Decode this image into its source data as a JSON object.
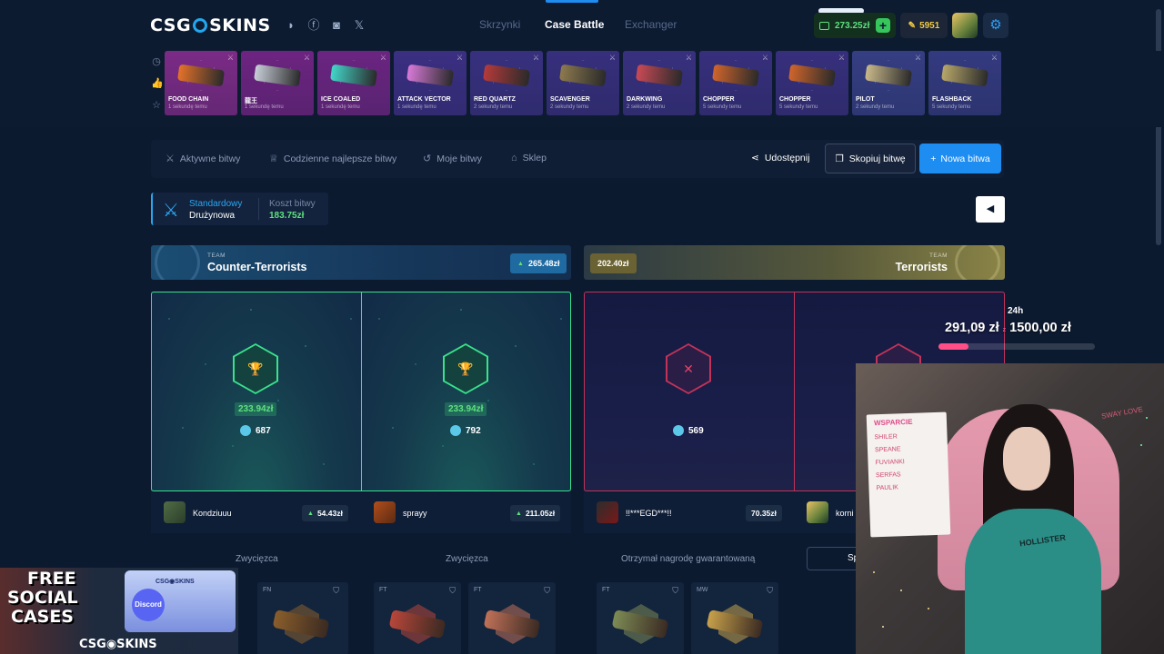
{
  "header": {
    "logo": "CSG◉SKINS",
    "nav": [
      "Skrzynki",
      "Case Battle",
      "Exchanger"
    ],
    "balance": "273.25zł",
    "points": "5951"
  },
  "drops": [
    {
      "name": "FOOD CHAIN",
      "time": "1 sekundę temu",
      "bg": "#7b2b86",
      "gun": "#e4722a"
    },
    {
      "name": "龍王",
      "time": "1 sekundę temu",
      "bg": "#6d2481",
      "gun": "#c8cfd8"
    },
    {
      "name": "ICE COALED",
      "time": "1 sekundę temu",
      "bg": "#6b2581",
      "gun": "#43d6c9"
    },
    {
      "name": "ATTACK VECTOR",
      "time": "1 sekundę temu",
      "bg": "#3b2f82",
      "gun": "#d87ad8"
    },
    {
      "name": "RED QUARTZ",
      "time": "2 sekundy temu",
      "bg": "#38307e",
      "gun": "#b53a3a"
    },
    {
      "name": "SCAVENGER",
      "time": "2 sekundy temu",
      "bg": "#372f7c",
      "gun": "#8d7a4e"
    },
    {
      "name": "DARKWING",
      "time": "2 sekundy temu",
      "bg": "#38307e",
      "gun": "#c94a55"
    },
    {
      "name": "CHOPPER",
      "time": "5 sekundy temu",
      "bg": "#372f7c",
      "gun": "#d0652b"
    },
    {
      "name": "CHOPPER",
      "time": "5 sekundy temu",
      "bg": "#372f7c",
      "gun": "#d0652b"
    },
    {
      "name": "PILOT",
      "time": "2 sekundy temu",
      "bg": "#363e83",
      "gun": "#c9b98a"
    },
    {
      "name": "FLASHBACK",
      "time": "5 sekundy temu",
      "bg": "#343a7f",
      "gun": "#b7a76a"
    }
  ],
  "subnav": {
    "items": [
      "Aktywne bitwy",
      "Codzienne najlepsze bitwy",
      "Moje bitwy",
      "Sklep"
    ],
    "share": "Udostępnij",
    "copy": "Skopiuj bitwę",
    "new": "Nowa bitwa"
  },
  "battle": {
    "mode1": "Standardowy",
    "mode2": "Drużynowa",
    "cost_label": "Koszt bitwy",
    "cost_value": "183.75zł"
  },
  "teams": {
    "ct": {
      "small": "TEAM",
      "name": "Counter-Terrorists",
      "value": "265.48zł"
    },
    "t": {
      "small": "TEAM",
      "name": "Terrorists",
      "value": "202.40zł"
    }
  },
  "panels": [
    {
      "win": "233.94zł",
      "coins": "687"
    },
    {
      "win": "233.94zł",
      "coins": "792"
    },
    {
      "coins": "569"
    }
  ],
  "players": [
    {
      "name": "Kondziuuu",
      "value": "54.43zł"
    },
    {
      "name": "sprayy",
      "value": "211.05zł"
    },
    {
      "name": "!!***EGD***!!",
      "value": "70.35zł"
    },
    {
      "name": "korni"
    }
  ],
  "results": [
    "Zwycięzca",
    "Zwycięzca",
    "Otrzymał nagrodę gwarantowaną"
  ],
  "spin_label": "Sp",
  "items": [
    {
      "cond": "FT",
      "color": "#d6622e"
    },
    {
      "cond": "FN",
      "color": "#8a5e2b"
    },
    {
      "cond": "FT",
      "color": "#b8463a"
    },
    {
      "cond": "FT",
      "color": "#c07158"
    },
    {
      "cond": "FT",
      "color": "#7d8b55"
    },
    {
      "cond": "MW",
      "color": "#c7a14b"
    }
  ],
  "overlay": {
    "label": "24h",
    "current": "291,09 zł",
    "separator": "z",
    "goal": "1500,00 zł",
    "progress": 0.194
  },
  "promo": {
    "line1": "FREE",
    "line2": "SOCIAL",
    "line3": "CASES",
    "box_label": "CSG◉SKINS",
    "discord": "Discord",
    "logo": "CSG◉SKINS"
  },
  "webcam": {
    "board_title": "WSPARCIE",
    "board_lines": [
      "SHILER",
      "SPEANE",
      "FUVIANKI",
      "SERFAS",
      "PAULIK"
    ],
    "shirt_text": "HOLLISTER",
    "wall_text": "SWAY LOVE"
  }
}
